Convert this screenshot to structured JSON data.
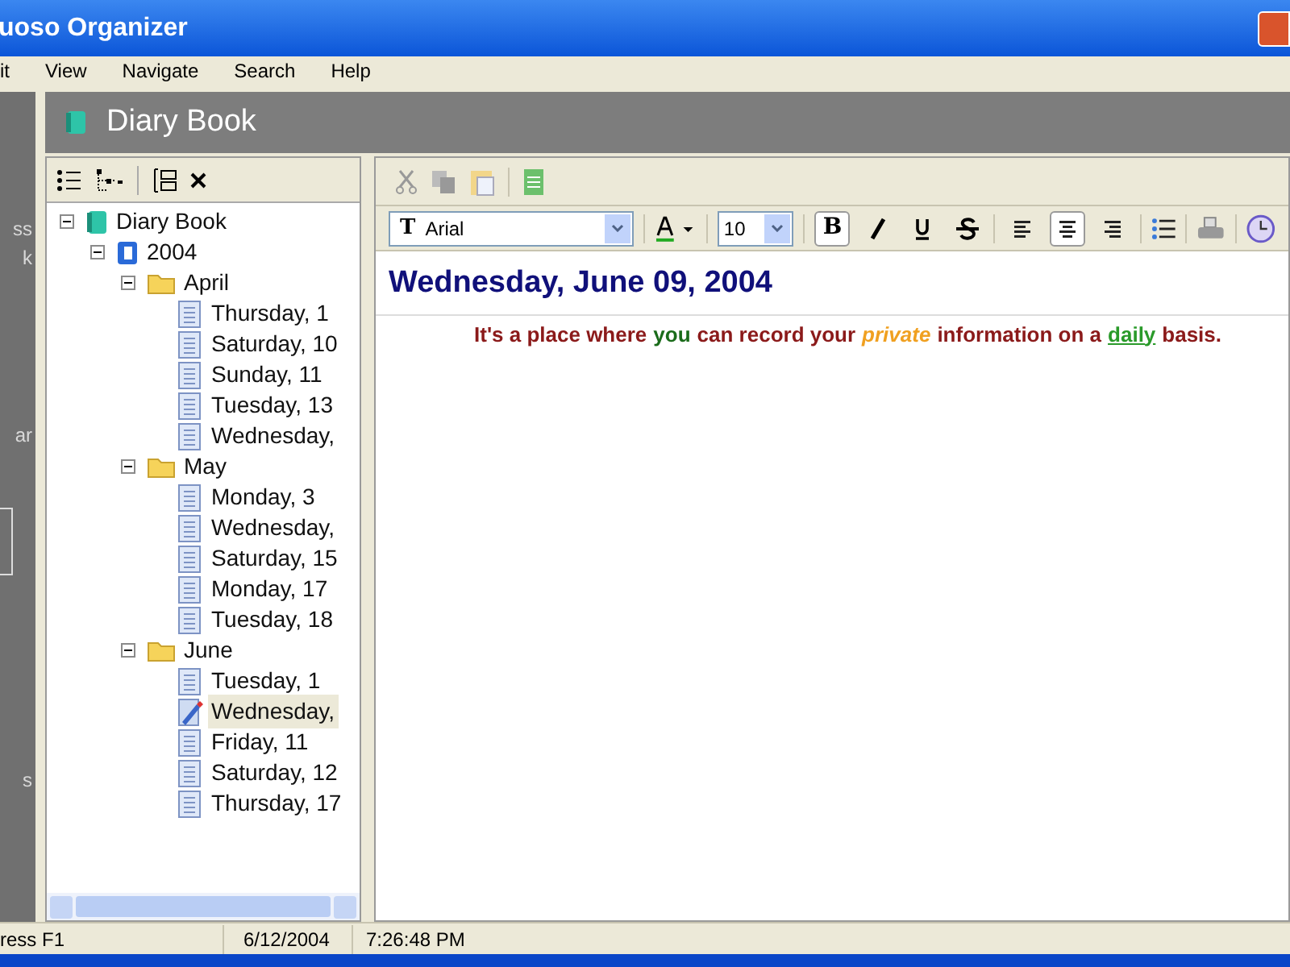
{
  "window": {
    "title": "uoso Organizer"
  },
  "menu": [
    "it",
    "View",
    "Navigate",
    "Search",
    "Help"
  ],
  "sidebar": {
    "fragments": [
      "ss",
      "k",
      "ar",
      "s"
    ]
  },
  "header": {
    "title": "Diary Book"
  },
  "tree": {
    "items": [
      {
        "label": "Diary Book",
        "kind": "book",
        "expanded": true,
        "selected": false,
        "children": [
          {
            "label": "2004",
            "kind": "year",
            "expanded": true,
            "selected": false,
            "children": [
              {
                "label": "April",
                "kind": "folder",
                "expanded": true,
                "selected": false,
                "children": [
                  {
                    "label": "Thursday, 1",
                    "kind": "page",
                    "selected": false
                  },
                  {
                    "label": "Saturday, 10",
                    "kind": "page",
                    "selected": false
                  },
                  {
                    "label": "Sunday, 11",
                    "kind": "page",
                    "selected": false
                  },
                  {
                    "label": "Tuesday, 13",
                    "kind": "page",
                    "selected": false
                  },
                  {
                    "label": "Wednesday,",
                    "kind": "page",
                    "selected": false
                  }
                ]
              },
              {
                "label": "May",
                "kind": "folder",
                "expanded": true,
                "selected": false,
                "children": [
                  {
                    "label": "Monday, 3",
                    "kind": "page",
                    "selected": false
                  },
                  {
                    "label": "Wednesday,",
                    "kind": "page",
                    "selected": false
                  },
                  {
                    "label": "Saturday, 15",
                    "kind": "page",
                    "selected": false
                  },
                  {
                    "label": "Monday, 17",
                    "kind": "page",
                    "selected": false
                  },
                  {
                    "label": "Tuesday, 18",
                    "kind": "page",
                    "selected": false
                  }
                ]
              },
              {
                "label": "June",
                "kind": "folder",
                "expanded": true,
                "selected": false,
                "children": [
                  {
                    "label": "Tuesday, 1",
                    "kind": "page",
                    "selected": false
                  },
                  {
                    "label": "Wednesday,",
                    "kind": "page",
                    "selected": true
                  },
                  {
                    "label": "Friday, 11",
                    "kind": "page",
                    "selected": false
                  },
                  {
                    "label": "Saturday, 12",
                    "kind": "page",
                    "selected": false
                  },
                  {
                    "label": "Thursday, 17",
                    "kind": "page",
                    "selected": false
                  }
                ]
              }
            ]
          }
        ]
      }
    ]
  },
  "editor": {
    "font_icon": "T",
    "font": "Arial",
    "size": "10",
    "format_buttons": [
      {
        "kind": "bold",
        "label": "B",
        "selected": true
      },
      {
        "kind": "italic",
        "selected": false
      },
      {
        "kind": "underline",
        "selected": false
      },
      {
        "kind": "strike",
        "selected": false
      }
    ],
    "align_buttons": [
      {
        "kind": "left",
        "selected": false
      },
      {
        "kind": "center",
        "selected": true
      },
      {
        "kind": "right",
        "selected": false
      }
    ],
    "heading": "Wednesday, June 09, 2004",
    "body": [
      {
        "text": "It's a place where",
        "kind": "plain",
        "color": "#8b1a1a"
      },
      {
        "text": "you",
        "kind": "plain",
        "color": "#1a6b1a"
      },
      {
        "text": "can record your",
        "kind": "plain",
        "color": "#8b1a1a"
      },
      {
        "text": "private",
        "kind": "italic",
        "color": "#f0a020"
      },
      {
        "text": "information on a",
        "kind": "plain",
        "color": "#8b1a1a"
      },
      {
        "text": "daily",
        "kind": "underline",
        "color": "#2a9a2a"
      },
      {
        "text": "basis.",
        "kind": "plain",
        "color": "#8b1a1a"
      }
    ]
  },
  "status_bar": [
    "ress F1",
    "6/12/2004",
    "7:26:48 PM"
  ]
}
